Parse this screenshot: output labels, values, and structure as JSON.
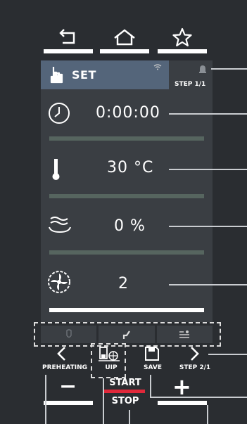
{
  "header": {
    "icons": [
      "back-icon",
      "home-icon",
      "star-icon"
    ]
  },
  "program": {
    "mode_label": "SET",
    "step_label": "STEP 1/1"
  },
  "params": {
    "time": "0:00:00",
    "temperature": "30 °C",
    "humidity": "0 %",
    "fan_speed": "2"
  },
  "footer": {
    "preheating_label": "PREHEATING",
    "uip_label": "UIP",
    "save_label": "SAVE",
    "step_next_label": "STEP 2/1",
    "start_label": "START",
    "stop_label": "STOP",
    "minus_label": "−",
    "plus_label": "+"
  },
  "colors": {
    "background": "#2a2d31",
    "panel": "#3a3e43",
    "setbar": "#54657a",
    "separator": "#56655f",
    "start_underline": "#e0283a"
  }
}
